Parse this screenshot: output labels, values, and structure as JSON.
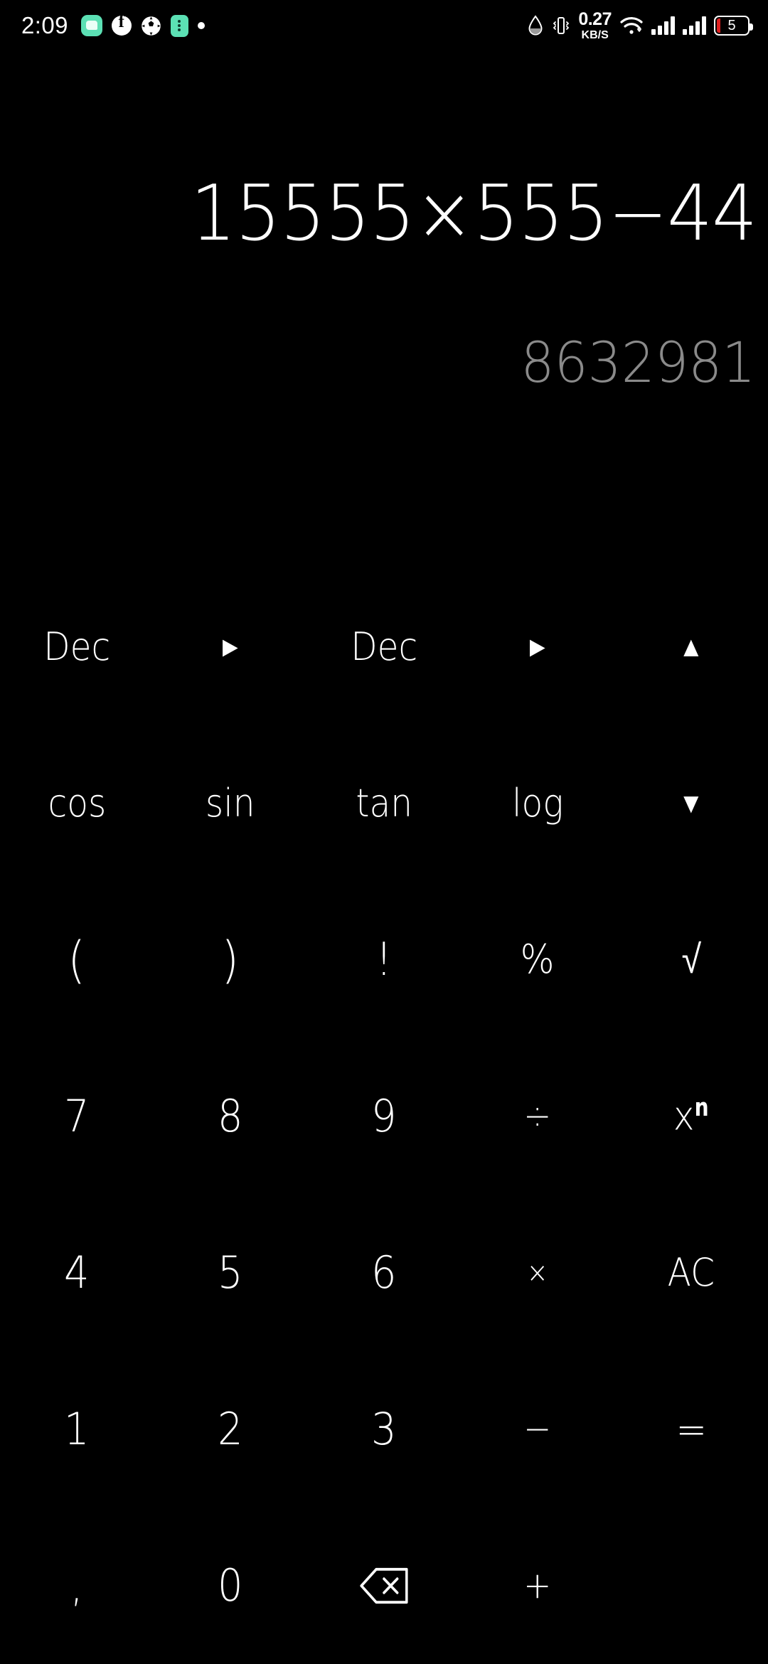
{
  "statusbar": {
    "time": "2:09",
    "icons_left": [
      "message-icon",
      "facebook-icon",
      "football-icon",
      "app-icon",
      "dot-icon"
    ],
    "network_speed_value": "0.27",
    "network_speed_unit": "KB/S",
    "icons_right": [
      "water-drop-icon",
      "vibrate-icon",
      "wifi-icon",
      "signal-icon",
      "signal-icon"
    ],
    "battery_level": "5",
    "accent_green": "#5ce0b4",
    "battery_red": "#e02020"
  },
  "display": {
    "expression": "15555×555−44",
    "result": "8632981",
    "expression_color": "#ffffff",
    "result_color": "#8a8a8a"
  },
  "keypad": {
    "rows": [
      [
        {
          "label": "Dec",
          "name": "base-from-dec-button",
          "cls": "k-word"
        },
        {
          "label": "►",
          "name": "convert-arrow-button",
          "cls": "k-tri"
        },
        {
          "label": "Dec",
          "name": "base-to-dec-button",
          "cls": "k-word"
        },
        {
          "label": "►",
          "name": "convert-arrow-2-button",
          "cls": "k-tri"
        },
        {
          "label": "▲",
          "name": "scroll-up-button",
          "cls": "k-tri"
        }
      ],
      [
        {
          "label": "cos",
          "name": "cos-button",
          "cls": "k-word"
        },
        {
          "label": "sin",
          "name": "sin-button",
          "cls": "k-word"
        },
        {
          "label": "tan",
          "name": "tan-button",
          "cls": "k-word"
        },
        {
          "label": "log",
          "name": "log-button",
          "cls": "k-word"
        },
        {
          "label": "▼",
          "name": "scroll-down-button",
          "cls": "k-tri"
        }
      ],
      [
        {
          "label": "(",
          "name": "open-paren-button",
          "cls": "k-paren"
        },
        {
          "label": ")",
          "name": "close-paren-button",
          "cls": "k-paren"
        },
        {
          "label": "!",
          "name": "factorial-button",
          "cls": "k-bang"
        },
        {
          "label": "%",
          "name": "percent-button",
          "cls": "k-sym"
        },
        {
          "label": "√",
          "name": "sqrt-button",
          "cls": "k-root"
        }
      ],
      [
        {
          "label": "7",
          "name": "digit-7-button",
          "cls": "k-num"
        },
        {
          "label": "8",
          "name": "digit-8-button",
          "cls": "k-num"
        },
        {
          "label": "9",
          "name": "digit-9-button",
          "cls": "k-num"
        },
        {
          "label": "÷",
          "name": "divide-button",
          "cls": "k-op"
        },
        {
          "label": "xⁿ",
          "name": "power-button",
          "cls": "k-pow",
          "html": "x<sup>n</sup>"
        }
      ],
      [
        {
          "label": "4",
          "name": "digit-4-button",
          "cls": "k-num"
        },
        {
          "label": "5",
          "name": "digit-5-button",
          "cls": "k-num"
        },
        {
          "label": "6",
          "name": "digit-6-button",
          "cls": "k-num"
        },
        {
          "label": "×",
          "name": "multiply-button",
          "cls": "k-small"
        },
        {
          "label": "AC",
          "name": "all-clear-button",
          "cls": "k-word"
        }
      ],
      [
        {
          "label": "1",
          "name": "digit-1-button",
          "cls": "k-num"
        },
        {
          "label": "2",
          "name": "digit-2-button",
          "cls": "k-num"
        },
        {
          "label": "3",
          "name": "digit-3-button",
          "cls": "k-num"
        },
        {
          "label": "−",
          "name": "minus-button",
          "cls": "k-op"
        },
        {
          "label": "=",
          "name": "equals-button",
          "cls": "k-eq"
        }
      ],
      [
        {
          "label": ",",
          "name": "decimal-separator-button",
          "cls": "k-comma"
        },
        {
          "label": "0",
          "name": "digit-0-button",
          "cls": "k-num"
        },
        {
          "label": "⌫",
          "name": "backspace-button",
          "cls": "k-del"
        },
        {
          "label": "+",
          "name": "plus-button",
          "cls": "k-op"
        },
        {
          "label": "",
          "name": "empty-key",
          "cls": "blank"
        }
      ]
    ]
  }
}
